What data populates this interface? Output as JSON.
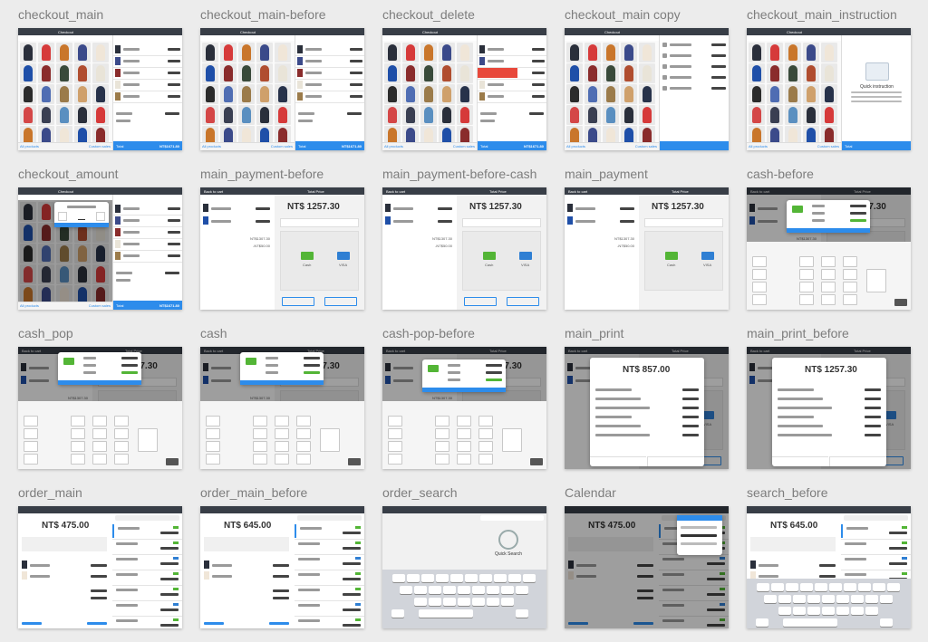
{
  "tiles": [
    {
      "title": "checkout_main",
      "kind": "grid_cart"
    },
    {
      "title": "checkout_main-before",
      "kind": "grid_cart"
    },
    {
      "title": "checkout_delete",
      "kind": "grid_delete"
    },
    {
      "title": "checkout_main copy",
      "kind": "grid_list"
    },
    {
      "title": "checkout_main_instruction",
      "kind": "grid_instruction"
    },
    {
      "title": "checkout_amount",
      "kind": "grid_amount"
    },
    {
      "title": "main_payment-before",
      "kind": "payment_before"
    },
    {
      "title": "main_payment-before-cash",
      "kind": "payment_before"
    },
    {
      "title": "main_payment",
      "kind": "payment"
    },
    {
      "title": "cash-before",
      "kind": "cash_before"
    },
    {
      "title": "cash_pop",
      "kind": "cash_pop"
    },
    {
      "title": "cash",
      "kind": "cash"
    },
    {
      "title": "cash-pop-before",
      "kind": "cash_pop_before"
    },
    {
      "title": "main_print",
      "kind": "print"
    },
    {
      "title": "main_print_before",
      "kind": "print_before"
    },
    {
      "title": "order_main",
      "kind": "order"
    },
    {
      "title": "order_main_before",
      "kind": "order"
    },
    {
      "title": "order_search",
      "kind": "order_search"
    },
    {
      "title": "Calendar",
      "kind": "calendar"
    },
    {
      "title": "search_before",
      "kind": "search_before"
    }
  ],
  "colors": {
    "accent": "#2d8ceb",
    "header": "#383e47",
    "delete": "#e8483b",
    "cash_green": "#53b536",
    "card_blue": "#2f7fd3"
  },
  "text": {
    "total_label": "Total",
    "total_value": "NT$1671.80",
    "price_payment": "NT$ 1257.30",
    "price_print": "NT$ 857.00",
    "price_order_a": "NT$ 475.00",
    "price_order_b": "NT$ 645.00",
    "quick_instruction": "Quick instruction",
    "quick_search": "Quick Search",
    "payment_title": "Total Price",
    "back_to_cart": "Back to cart",
    "checkout": "Checkout",
    "all_products": "All products",
    "custom_sales": "Custom sales",
    "cash_label": "Cash",
    "visa_label": "VISA",
    "subtotal_value": "NT$1307.30",
    "discount_value": "-NT$50.00",
    "enter_label": "Enter"
  }
}
